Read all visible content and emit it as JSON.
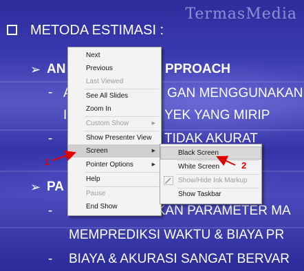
{
  "slide": {
    "watermark": "TermasMedia",
    "title": "METODA ESTIMASI :",
    "lines": [
      {
        "bullet": "arrow",
        "text": "AN",
        "text2": "PPROACH"
      },
      {
        "bullet": "dash",
        "text": "A",
        "text2": "GAN MENGGUNAKAN"
      },
      {
        "bullet": "none",
        "text": "I",
        "text2": "YEK YANG MIRIP"
      },
      {
        "bullet": "dash",
        "text": "",
        "text2": "TIDAK AKURAT"
      },
      {
        "bullet": "arrow",
        "text": "PA",
        "text2": ""
      },
      {
        "bullet": "dash",
        "text": "",
        "text2": "MEMPERKIRAKAN PARAMETER MA"
      },
      {
        "bullet": "none",
        "text": "",
        "text2": "MEMPREDIKSI WAKTU & BIAYA PR"
      },
      {
        "bullet": "dash",
        "text": "",
        "text2": "BIAYA & AKURASI SANGAT BERVAR"
      }
    ]
  },
  "context_menu": {
    "items": [
      {
        "label": "Next",
        "enabled": true
      },
      {
        "label": "Previous",
        "enabled": true
      },
      {
        "label": "Last Viewed",
        "enabled": false
      },
      {
        "label": "See All Slides",
        "enabled": true
      },
      {
        "label": "Zoom In",
        "enabled": true
      },
      {
        "label": "Custom Show",
        "enabled": false,
        "submenu": true
      },
      {
        "label": "Show Presenter View",
        "enabled": true
      },
      {
        "label": "Screen",
        "enabled": true,
        "submenu": true,
        "highlighted": true
      },
      {
        "label": "Pointer Options",
        "enabled": true,
        "submenu": true
      },
      {
        "label": "Help",
        "enabled": true
      },
      {
        "label": "Pause",
        "enabled": false
      },
      {
        "label": "End Show",
        "enabled": true
      }
    ]
  },
  "screen_submenu": {
    "items": [
      {
        "label": "Black Screen",
        "enabled": true,
        "highlighted": true
      },
      {
        "label": "White Screen",
        "enabled": true
      },
      {
        "label": "Show/Hide Ink Markup",
        "enabled": false,
        "icon": "ink-markup-icon"
      },
      {
        "label": "Show Taskbar",
        "enabled": true
      }
    ]
  },
  "annotations": {
    "step1": "1",
    "step2": "2"
  },
  "colors": {
    "annotation": "#e00000",
    "slide_bg": "#3a3ab0",
    "menu_bg": "#f3f3f3"
  }
}
